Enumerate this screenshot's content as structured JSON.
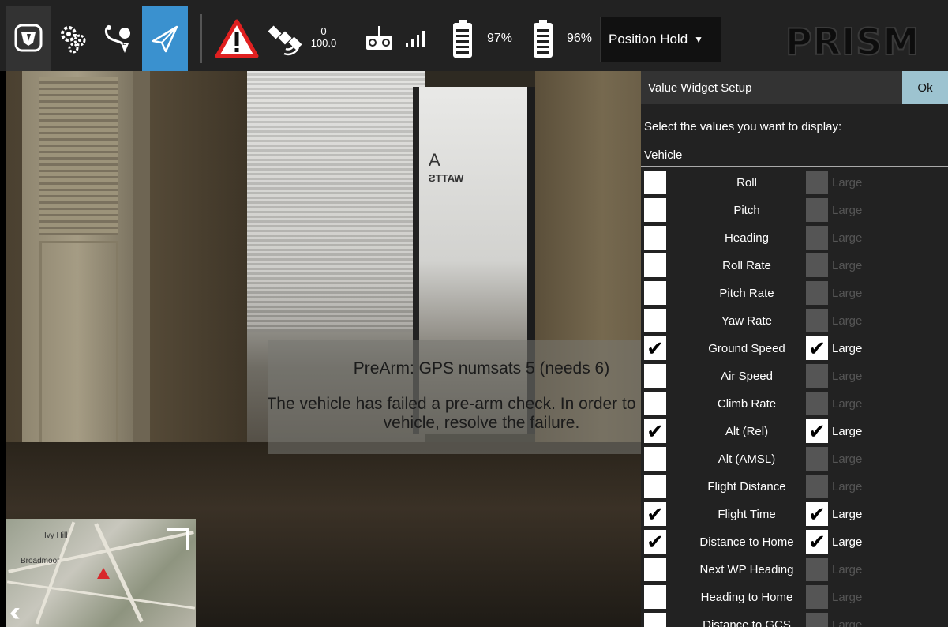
{
  "toolbar": {
    "satellite_count": "0",
    "hdop": "100.0",
    "battery_1": "97%",
    "battery_2": "96%",
    "flight_mode": "Position Hold",
    "brand": "PRISM"
  },
  "video": {
    "sign_letter": "A",
    "sign_name": "WATTS"
  },
  "prearm": {
    "title": "PreArm: GPS numsats 5 (needs 6)",
    "message": "The vehicle has failed a pre-arm check. In order to arm the vehicle, resolve the failure."
  },
  "minimap": {
    "labels": [
      "Ivy Hill",
      "Broadmoor"
    ]
  },
  "panel": {
    "title": "Value Widget Setup",
    "ok_label": "Ok",
    "instructions": "Select the values you want to display:",
    "category": "Vehicle",
    "large_label": "Large",
    "values": [
      {
        "name": "Roll",
        "selected": false,
        "large": false
      },
      {
        "name": "Pitch",
        "selected": false,
        "large": false
      },
      {
        "name": "Heading",
        "selected": false,
        "large": false
      },
      {
        "name": "Roll Rate",
        "selected": false,
        "large": false
      },
      {
        "name": "Pitch Rate",
        "selected": false,
        "large": false
      },
      {
        "name": "Yaw Rate",
        "selected": false,
        "large": false
      },
      {
        "name": "Ground Speed",
        "selected": true,
        "large": true
      },
      {
        "name": "Air Speed",
        "selected": false,
        "large": false
      },
      {
        "name": "Climb Rate",
        "selected": false,
        "large": false
      },
      {
        "name": "Alt (Rel)",
        "selected": true,
        "large": true
      },
      {
        "name": "Alt (AMSL)",
        "selected": false,
        "large": false
      },
      {
        "name": "Flight Distance",
        "selected": false,
        "large": false
      },
      {
        "name": "Flight Time",
        "selected": true,
        "large": true
      },
      {
        "name": "Distance to Home",
        "selected": true,
        "large": true
      },
      {
        "name": "Next WP Heading",
        "selected": false,
        "large": false
      },
      {
        "name": "Heading to Home",
        "selected": false,
        "large": false
      },
      {
        "name": "Distance to GCS",
        "selected": false,
        "large": false
      }
    ]
  },
  "colors": {
    "toolbar_bg": "#222222",
    "active_tool": "#3a91cf",
    "ok_button": "#9dc3d0",
    "warning": "#e02020"
  },
  "icons": [
    "app-logo-icon",
    "settings-gears-icon",
    "plan-route-icon",
    "fly-paper-plane-icon",
    "warning-triangle-icon",
    "satellite-icon",
    "rc-transmitter-icon",
    "signal-bars-icon",
    "battery-icon",
    "caret-down-icon",
    "check-icon",
    "collapse-chevrons-icon"
  ]
}
